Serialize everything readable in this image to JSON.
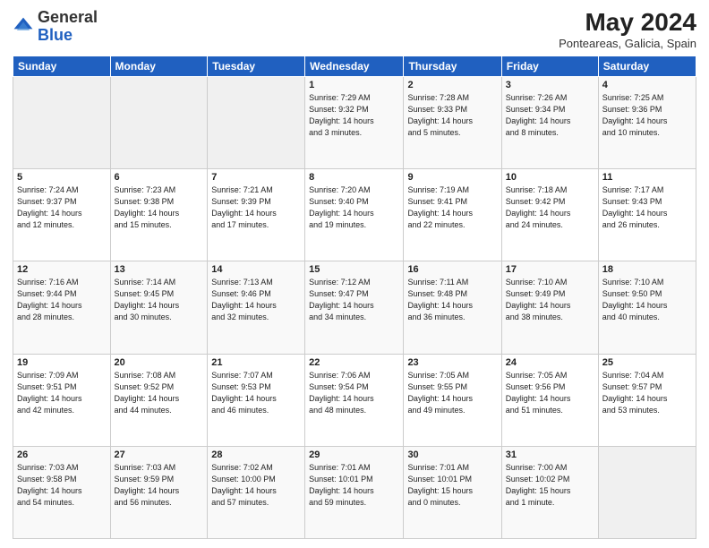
{
  "header": {
    "logo_general": "General",
    "logo_blue": "Blue",
    "month_title": "May 2024",
    "subtitle": "Ponteareas, Galicia, Spain"
  },
  "days_of_week": [
    "Sunday",
    "Monday",
    "Tuesday",
    "Wednesday",
    "Thursday",
    "Friday",
    "Saturday"
  ],
  "weeks": [
    [
      {
        "day": "",
        "info": ""
      },
      {
        "day": "",
        "info": ""
      },
      {
        "day": "",
        "info": ""
      },
      {
        "day": "1",
        "info": "Sunrise: 7:29 AM\nSunset: 9:32 PM\nDaylight: 14 hours\nand 3 minutes."
      },
      {
        "day": "2",
        "info": "Sunrise: 7:28 AM\nSunset: 9:33 PM\nDaylight: 14 hours\nand 5 minutes."
      },
      {
        "day": "3",
        "info": "Sunrise: 7:26 AM\nSunset: 9:34 PM\nDaylight: 14 hours\nand 8 minutes."
      },
      {
        "day": "4",
        "info": "Sunrise: 7:25 AM\nSunset: 9:36 PM\nDaylight: 14 hours\nand 10 minutes."
      }
    ],
    [
      {
        "day": "5",
        "info": "Sunrise: 7:24 AM\nSunset: 9:37 PM\nDaylight: 14 hours\nand 12 minutes."
      },
      {
        "day": "6",
        "info": "Sunrise: 7:23 AM\nSunset: 9:38 PM\nDaylight: 14 hours\nand 15 minutes."
      },
      {
        "day": "7",
        "info": "Sunrise: 7:21 AM\nSunset: 9:39 PM\nDaylight: 14 hours\nand 17 minutes."
      },
      {
        "day": "8",
        "info": "Sunrise: 7:20 AM\nSunset: 9:40 PM\nDaylight: 14 hours\nand 19 minutes."
      },
      {
        "day": "9",
        "info": "Sunrise: 7:19 AM\nSunset: 9:41 PM\nDaylight: 14 hours\nand 22 minutes."
      },
      {
        "day": "10",
        "info": "Sunrise: 7:18 AM\nSunset: 9:42 PM\nDaylight: 14 hours\nand 24 minutes."
      },
      {
        "day": "11",
        "info": "Sunrise: 7:17 AM\nSunset: 9:43 PM\nDaylight: 14 hours\nand 26 minutes."
      }
    ],
    [
      {
        "day": "12",
        "info": "Sunrise: 7:16 AM\nSunset: 9:44 PM\nDaylight: 14 hours\nand 28 minutes."
      },
      {
        "day": "13",
        "info": "Sunrise: 7:14 AM\nSunset: 9:45 PM\nDaylight: 14 hours\nand 30 minutes."
      },
      {
        "day": "14",
        "info": "Sunrise: 7:13 AM\nSunset: 9:46 PM\nDaylight: 14 hours\nand 32 minutes."
      },
      {
        "day": "15",
        "info": "Sunrise: 7:12 AM\nSunset: 9:47 PM\nDaylight: 14 hours\nand 34 minutes."
      },
      {
        "day": "16",
        "info": "Sunrise: 7:11 AM\nSunset: 9:48 PM\nDaylight: 14 hours\nand 36 minutes."
      },
      {
        "day": "17",
        "info": "Sunrise: 7:10 AM\nSunset: 9:49 PM\nDaylight: 14 hours\nand 38 minutes."
      },
      {
        "day": "18",
        "info": "Sunrise: 7:10 AM\nSunset: 9:50 PM\nDaylight: 14 hours\nand 40 minutes."
      }
    ],
    [
      {
        "day": "19",
        "info": "Sunrise: 7:09 AM\nSunset: 9:51 PM\nDaylight: 14 hours\nand 42 minutes."
      },
      {
        "day": "20",
        "info": "Sunrise: 7:08 AM\nSunset: 9:52 PM\nDaylight: 14 hours\nand 44 minutes."
      },
      {
        "day": "21",
        "info": "Sunrise: 7:07 AM\nSunset: 9:53 PM\nDaylight: 14 hours\nand 46 minutes."
      },
      {
        "day": "22",
        "info": "Sunrise: 7:06 AM\nSunset: 9:54 PM\nDaylight: 14 hours\nand 48 minutes."
      },
      {
        "day": "23",
        "info": "Sunrise: 7:05 AM\nSunset: 9:55 PM\nDaylight: 14 hours\nand 49 minutes."
      },
      {
        "day": "24",
        "info": "Sunrise: 7:05 AM\nSunset: 9:56 PM\nDaylight: 14 hours\nand 51 minutes."
      },
      {
        "day": "25",
        "info": "Sunrise: 7:04 AM\nSunset: 9:57 PM\nDaylight: 14 hours\nand 53 minutes."
      }
    ],
    [
      {
        "day": "26",
        "info": "Sunrise: 7:03 AM\nSunset: 9:58 PM\nDaylight: 14 hours\nand 54 minutes."
      },
      {
        "day": "27",
        "info": "Sunrise: 7:03 AM\nSunset: 9:59 PM\nDaylight: 14 hours\nand 56 minutes."
      },
      {
        "day": "28",
        "info": "Sunrise: 7:02 AM\nSunset: 10:00 PM\nDaylight: 14 hours\nand 57 minutes."
      },
      {
        "day": "29",
        "info": "Sunrise: 7:01 AM\nSunset: 10:01 PM\nDaylight: 14 hours\nand 59 minutes."
      },
      {
        "day": "30",
        "info": "Sunrise: 7:01 AM\nSunset: 10:01 PM\nDaylight: 15 hours\nand 0 minutes."
      },
      {
        "day": "31",
        "info": "Sunrise: 7:00 AM\nSunset: 10:02 PM\nDaylight: 15 hours\nand 1 minute."
      },
      {
        "day": "",
        "info": ""
      }
    ]
  ]
}
